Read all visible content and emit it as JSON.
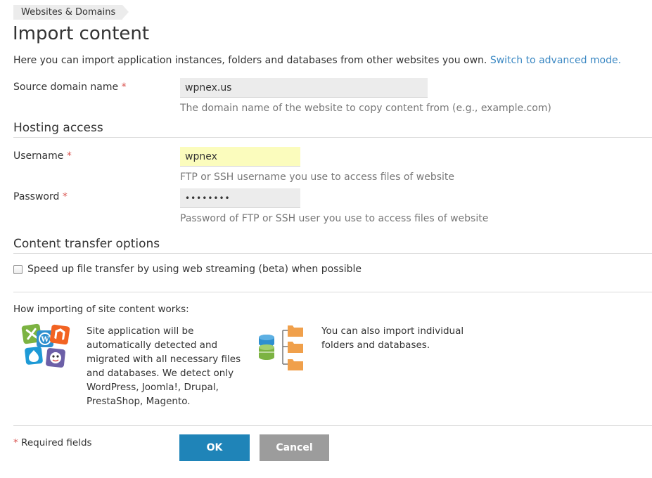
{
  "breadcrumb": {
    "label": "Websites & Domains"
  },
  "page": {
    "title": "Import content",
    "intro_text": "Here you can import application instances, folders and databases from other websites you own.",
    "advanced_link": "Switch to advanced mode."
  },
  "source": {
    "label": "Source domain name",
    "value": "wpnex.us",
    "hint": "The domain name of the website to copy content from (e.g., example.com)"
  },
  "hosting": {
    "title": "Hosting access",
    "username_label": "Username",
    "username_value": "wpnex",
    "username_hint": "FTP or SSH username you use to access files of website",
    "password_label": "Password",
    "password_value": "••••••••",
    "password_hint": "Password of FTP or SSH user you use to access files of website"
  },
  "transfer": {
    "title": "Content transfer options",
    "checkbox_label": "Speed up file transfer by using web streaming (beta) when possible",
    "checked": false
  },
  "how": {
    "title": "How importing of site content works:",
    "apps_text": "Site application will be automatically detected and migrated with all necessary files and databases. We detect only WordPress, Joomla!, Drupal, PrestaShop, Magento.",
    "files_text": "You can also import individual folders and databases."
  },
  "footer": {
    "required_mark": "*",
    "required_text": "Required fields",
    "ok_label": "OK",
    "cancel_label": "Cancel"
  },
  "required_marker": "*",
  "colors": {
    "link": "#3b88c3",
    "required": "#d9534f",
    "ok_button": "#1f84b8",
    "cancel_button": "#9c9c9c",
    "autofill": "#fbfcbd"
  },
  "icons": {
    "apps": "cms-apps-icon",
    "files": "files-and-databases-icon"
  }
}
